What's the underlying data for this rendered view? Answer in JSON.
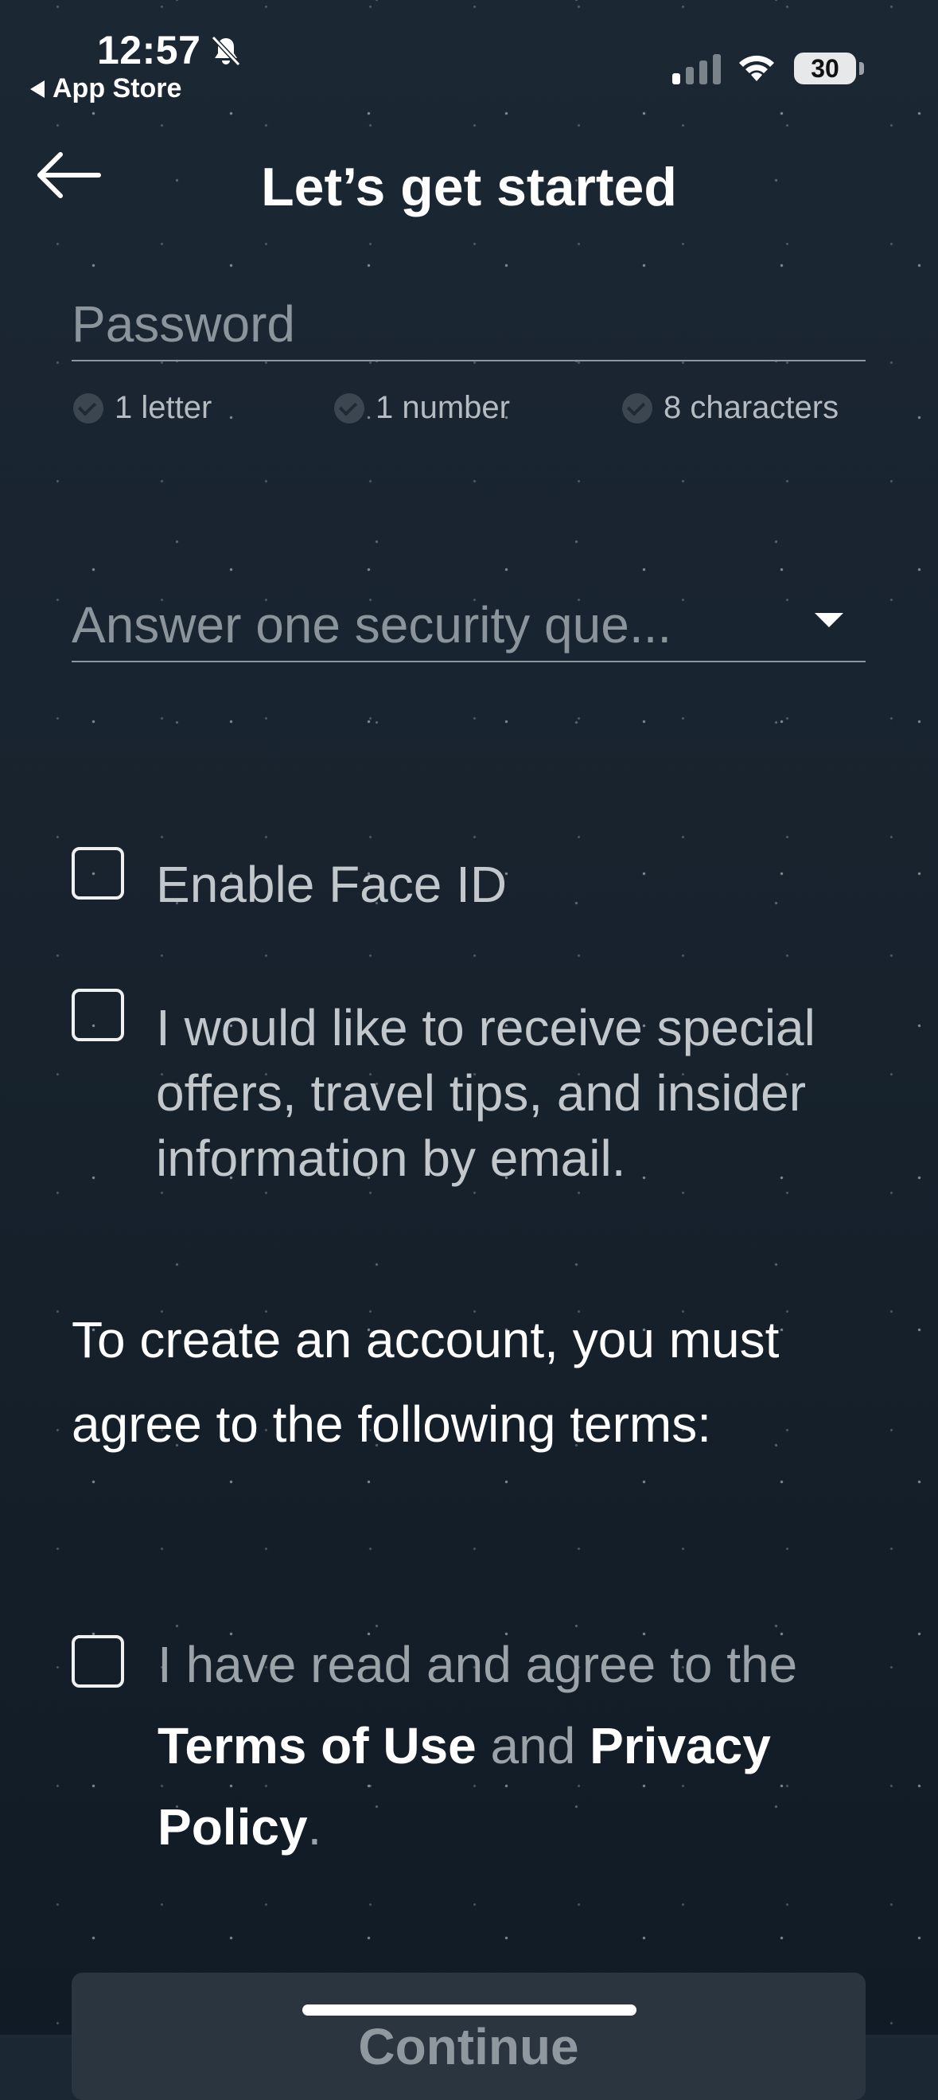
{
  "status_bar": {
    "time": "12:57",
    "back_app": "App Store",
    "battery": "30"
  },
  "header": {
    "title": "Let’s get started"
  },
  "password": {
    "placeholder": "Password",
    "requirements": [
      "1 letter",
      "1 number",
      "8 characters"
    ]
  },
  "security_question": {
    "placeholder": "Answer one security que..."
  },
  "options": {
    "face_id_label": "Enable Face ID",
    "offers_label": "I would like to receive special offers, travel tips, and insider information by email."
  },
  "terms": {
    "intro": "To create an account, you must agree to the following terms:",
    "agree_prefix": "I have read and agree to the",
    "terms_link": "Terms of Use",
    "and": "and",
    "privacy_link": "Privacy Policy",
    "period": "."
  },
  "actions": {
    "continue_label": "Continue"
  },
  "colors": {
    "background": "#1b2733",
    "button_bg": "#2a3540",
    "muted_text": "#8c949b"
  }
}
